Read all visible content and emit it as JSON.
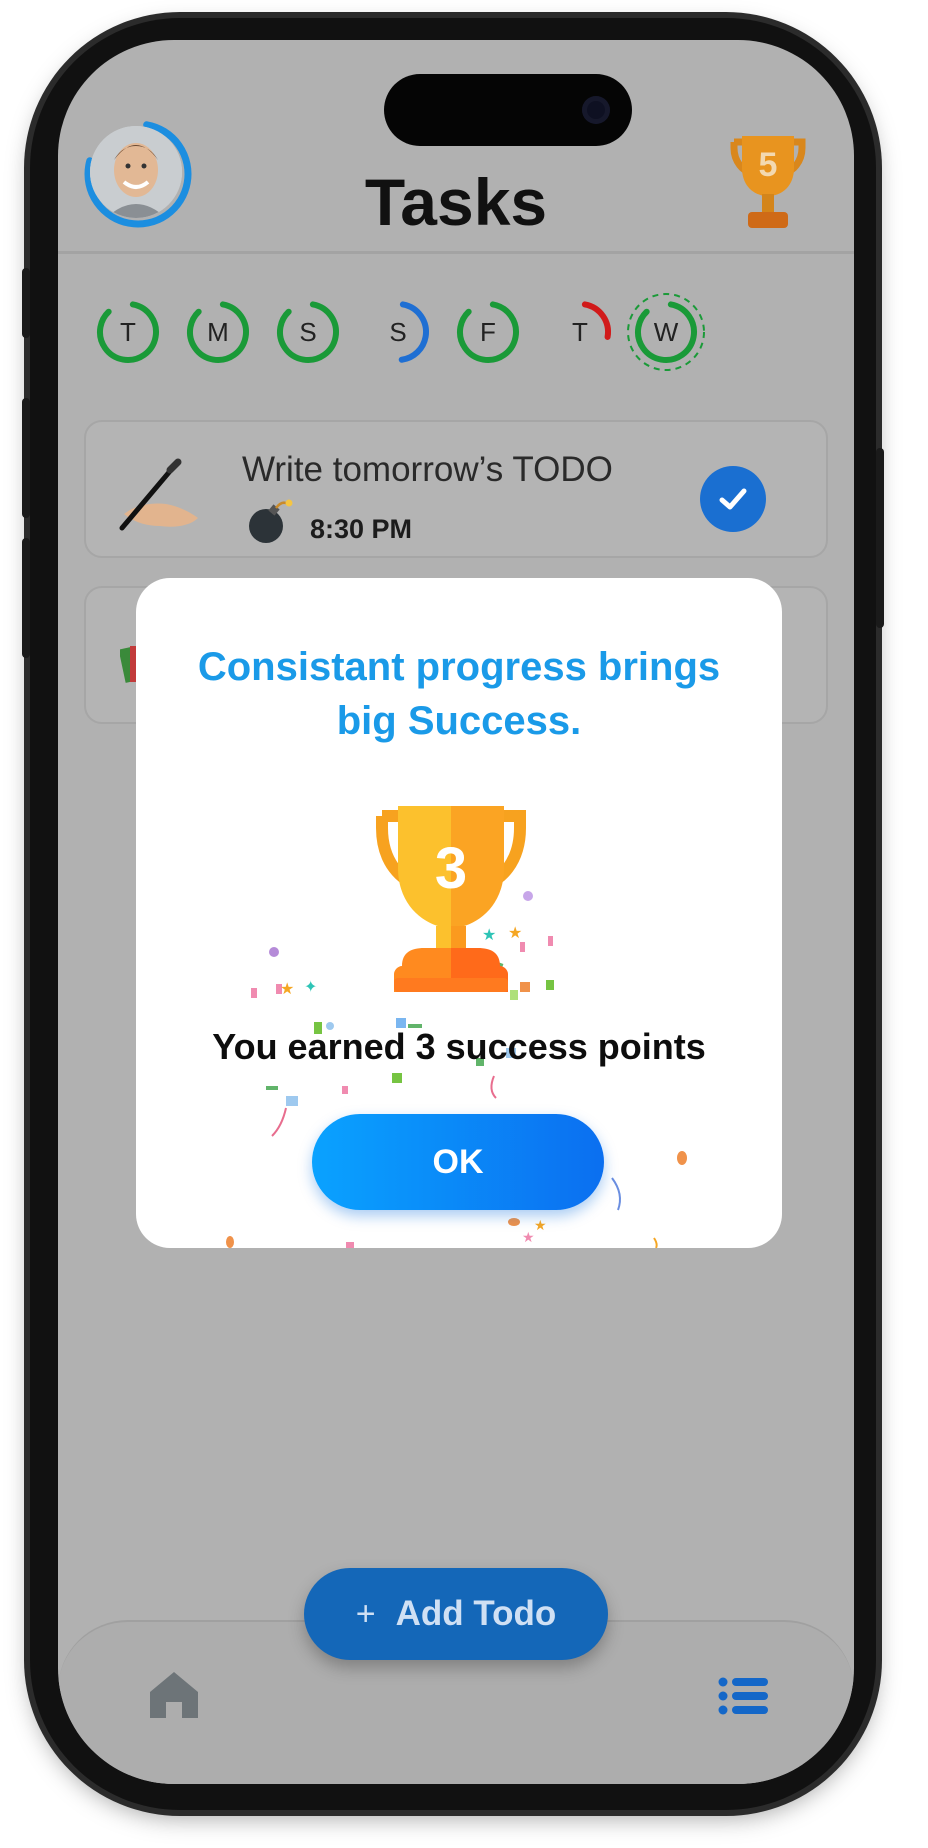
{
  "header": {
    "title": "Tasks",
    "trophy_points": "5"
  },
  "week": {
    "days": [
      {
        "label": "T",
        "color": "#1a9a38",
        "progress": 0.85,
        "selected": false
      },
      {
        "label": "M",
        "color": "#1a9a38",
        "progress": 0.85,
        "selected": false
      },
      {
        "label": "S",
        "color": "#1a9a38",
        "progress": 0.85,
        "selected": false
      },
      {
        "label": "S",
        "color": "#1f6fd3",
        "progress": 0.45,
        "selected": false
      },
      {
        "label": "F",
        "color": "#1a9a38",
        "progress": 0.85,
        "selected": false
      },
      {
        "label": "T",
        "color": "#d11a1a",
        "progress": 0.25,
        "selected": false
      },
      {
        "label": "W",
        "color": "#1a9a38",
        "progress": 0.85,
        "selected": true
      }
    ]
  },
  "tasks": [
    {
      "title": "Write tomorrow’s TODO",
      "time": "8:30 PM",
      "done": true,
      "icon": "writing-hand-icon",
      "time_icon": "bomb-icon"
    }
  ],
  "bottom": {
    "add_plus": "+",
    "add_label": "Add Todo",
    "home_icon": "home-icon",
    "list_icon": "list-icon"
  },
  "dialog": {
    "title": "Consistant progress brings big Success.",
    "trophy_points": "3",
    "message": "You earned 3 success points",
    "ok_label": "OK"
  },
  "colors": {
    "accent_blue": "#1a9ae8",
    "ok_gradient_start": "#0aa2ff",
    "ok_gradient_end": "#0b6ff0",
    "trophy_gold": "#f6a623"
  }
}
